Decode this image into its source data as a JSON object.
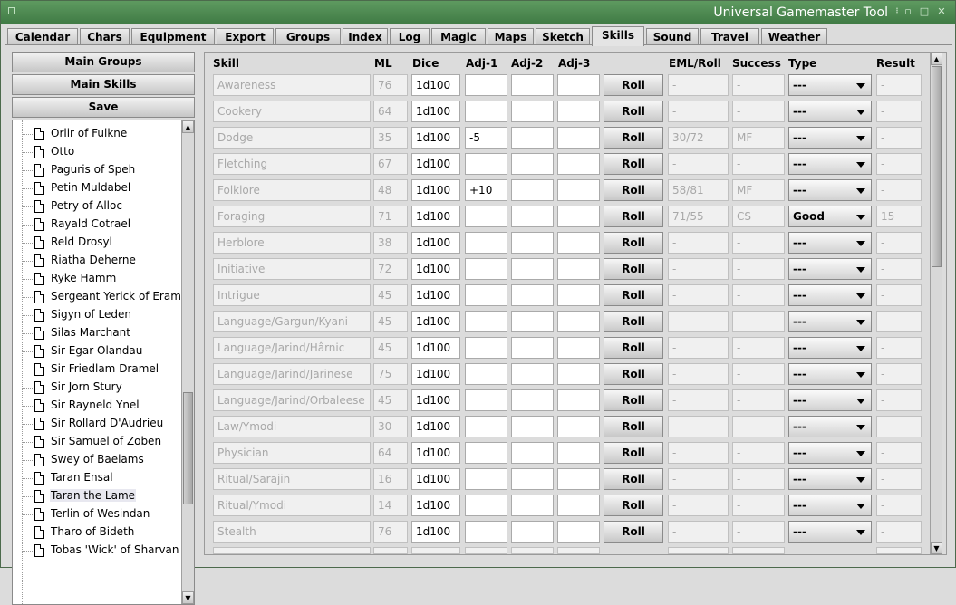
{
  "window": {
    "title": "Universal Gamemaster Tool"
  },
  "tabs": [
    "Calendar",
    "Chars",
    "Equipment",
    "Export",
    "Groups",
    "Index",
    "Log",
    "Magic",
    "Maps",
    "Sketch",
    "Skills",
    "Sound",
    "Travel",
    "Weather"
  ],
  "active_tab": "Skills",
  "left": {
    "buttons": {
      "main_groups": "Main Groups",
      "main_skills": "Main Skills",
      "save": "Save"
    },
    "tree_items": [
      "Orlir of Fulkne",
      "Otto",
      "Paguris of Speh",
      "Petin Muldabel",
      "Petry of Alloc",
      "Rayald Cotrael",
      "Reld Drosyl",
      "Riatha Deherne",
      "Ryke Hamm",
      "Sergeant Yerick of Eram",
      "Sigyn of Leden",
      "Silas Marchant",
      "Sir Egar Olandau",
      "Sir Friedlam Dramel",
      "Sir Jorn Stury",
      "Sir Rayneld Ynel",
      "Sir Rollard D'Audrieu",
      "Sir Samuel of Zoben",
      "Swey of Baelams",
      "Taran Ensal",
      "Taran the Lame",
      "Terlin of Wesindan",
      "Tharo of Bideth",
      "Tobas 'Wick' of Sharvan"
    ],
    "selected_item": "Taran the Lame"
  },
  "table": {
    "headers": {
      "skill": "Skill",
      "ml": "ML",
      "dice": "Dice",
      "adj1": "Adj-1",
      "adj2": "Adj-2",
      "adj3": "Adj-3",
      "eml": "EML/Roll",
      "success": "Success",
      "type": "Type",
      "result": "Result"
    },
    "roll_label": "Roll",
    "rows": [
      {
        "skill": "Awareness",
        "ml": "76",
        "dice": "1d100",
        "adj1": "",
        "adj2": "",
        "adj3": "",
        "eml": "-",
        "success": "-",
        "type": "---",
        "result": "-"
      },
      {
        "skill": "Cookery",
        "ml": "64",
        "dice": "1d100",
        "adj1": "",
        "adj2": "",
        "adj3": "",
        "eml": "-",
        "success": "-",
        "type": "---",
        "result": "-"
      },
      {
        "skill": "Dodge",
        "ml": "35",
        "dice": "1d100",
        "adj1": "-5",
        "adj2": "",
        "adj3": "",
        "eml": "30/72",
        "success": "MF",
        "type": "---",
        "result": "-"
      },
      {
        "skill": "Fletching",
        "ml": "67",
        "dice": "1d100",
        "adj1": "",
        "adj2": "",
        "adj3": "",
        "eml": "-",
        "success": "-",
        "type": "---",
        "result": "-"
      },
      {
        "skill": "Folklore",
        "ml": "48",
        "dice": "1d100",
        "adj1": "+10",
        "adj2": "",
        "adj3": "",
        "eml": "58/81",
        "success": "MF",
        "type": "---",
        "result": "-"
      },
      {
        "skill": "Foraging",
        "ml": "71",
        "dice": "1d100",
        "adj1": "",
        "adj2": "",
        "adj3": "",
        "eml": "71/55",
        "success": "CS",
        "type": "Good",
        "result": "15"
      },
      {
        "skill": "Herblore",
        "ml": "38",
        "dice": "1d100",
        "adj1": "",
        "adj2": "",
        "adj3": "",
        "eml": "-",
        "success": "-",
        "type": "---",
        "result": "-"
      },
      {
        "skill": "Initiative",
        "ml": "72",
        "dice": "1d100",
        "adj1": "",
        "adj2": "",
        "adj3": "",
        "eml": "-",
        "success": "-",
        "type": "---",
        "result": "-"
      },
      {
        "skill": "Intrigue",
        "ml": "45",
        "dice": "1d100",
        "adj1": "",
        "adj2": "",
        "adj3": "",
        "eml": "-",
        "success": "-",
        "type": "---",
        "result": "-"
      },
      {
        "skill": "Language/Gargun/Kyani",
        "ml": "45",
        "dice": "1d100",
        "adj1": "",
        "adj2": "",
        "adj3": "",
        "eml": "-",
        "success": "-",
        "type": "---",
        "result": "-"
      },
      {
        "skill": "Language/Jarind/Hârnic",
        "ml": "45",
        "dice": "1d100",
        "adj1": "",
        "adj2": "",
        "adj3": "",
        "eml": "-",
        "success": "-",
        "type": "---",
        "result": "-"
      },
      {
        "skill": "Language/Jarind/Jarinese",
        "ml": "75",
        "dice": "1d100",
        "adj1": "",
        "adj2": "",
        "adj3": "",
        "eml": "-",
        "success": "-",
        "type": "---",
        "result": "-"
      },
      {
        "skill": "Language/Jarind/Orbaleese",
        "ml": "45",
        "dice": "1d100",
        "adj1": "",
        "adj2": "",
        "adj3": "",
        "eml": "-",
        "success": "-",
        "type": "---",
        "result": "-"
      },
      {
        "skill": "Law/Ymodi",
        "ml": "30",
        "dice": "1d100",
        "adj1": "",
        "adj2": "",
        "adj3": "",
        "eml": "-",
        "success": "-",
        "type": "---",
        "result": "-"
      },
      {
        "skill": "Physician",
        "ml": "64",
        "dice": "1d100",
        "adj1": "",
        "adj2": "",
        "adj3": "",
        "eml": "-",
        "success": "-",
        "type": "---",
        "result": "-"
      },
      {
        "skill": "Ritual/Sarajin",
        "ml": "16",
        "dice": "1d100",
        "adj1": "",
        "adj2": "",
        "adj3": "",
        "eml": "-",
        "success": "-",
        "type": "---",
        "result": "-"
      },
      {
        "skill": "Ritual/Ymodi",
        "ml": "14",
        "dice": "1d100",
        "adj1": "",
        "adj2": "",
        "adj3": "",
        "eml": "-",
        "success": "-",
        "type": "---",
        "result": "-"
      },
      {
        "skill": "Stealth",
        "ml": "76",
        "dice": "1d100",
        "adj1": "",
        "adj2": "",
        "adj3": "",
        "eml": "-",
        "success": "-",
        "type": "---",
        "result": "-"
      }
    ]
  },
  "icons": {
    "window": "window-menu-icon",
    "minimize": "minimize-icon",
    "maximize": "maximize-icon",
    "close": "close-icon",
    "tree_item": "document-icon"
  }
}
